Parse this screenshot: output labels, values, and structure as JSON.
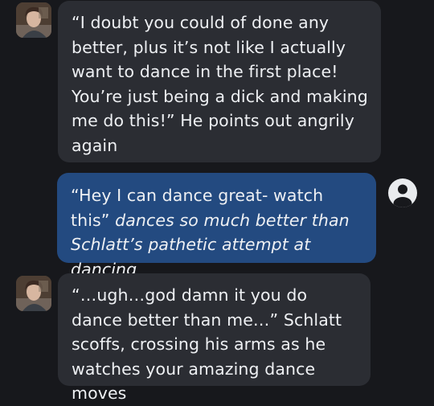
{
  "messages": [
    {
      "role": "character",
      "avatar_icon": "character-avatar",
      "text": "“I doubt you could of done any better, plus it’s not like I actually want to dance in the first place! You’re just being a dick and making me do this!” He points out angrily again"
    },
    {
      "role": "user",
      "avatar_icon": "user-profile-icon",
      "speech": "“Hey I can dance great- watch this”",
      "action": "dances so much better than Schlatt’s pathetic attempt at dancing"
    },
    {
      "role": "character",
      "avatar_icon": "character-avatar",
      "text": "“…ugh…god damn it you do dance better than me…” Schlatt scoffs, crossing his arms as he watches your amazing dance moves"
    }
  ],
  "colors": {
    "background": "#17181c",
    "character_bubble": "#2b2d33",
    "user_bubble": "#234a80",
    "text": "#eef0f3",
    "user_icon": "#e9ebee"
  }
}
